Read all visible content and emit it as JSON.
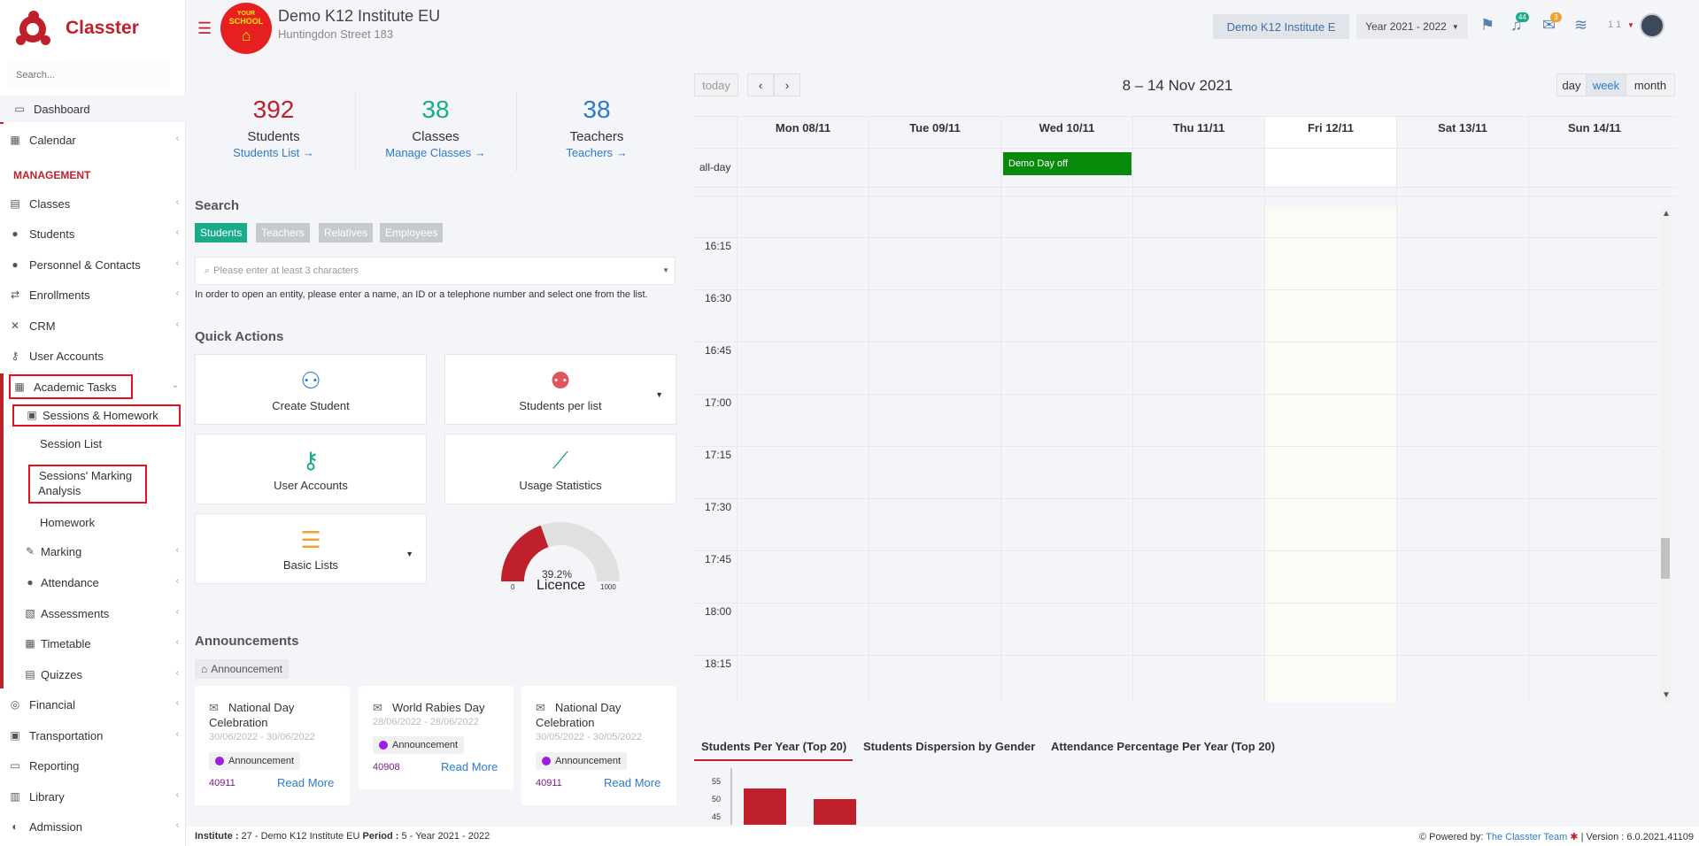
{
  "app": {
    "name": "Classter",
    "search_placeholder": "Search..."
  },
  "sidebar": {
    "dashboard": "Dashboard",
    "calendar": "Calendar",
    "management_header": "MANAGEMENT",
    "items": [
      "Classes",
      "Students",
      "Personnel & Contacts",
      "Enrollments",
      "CRM",
      "User Accounts"
    ],
    "academic_tasks": "Academic Tasks",
    "sessions_homework": "Sessions & Homework",
    "session_list": "Session List",
    "marking_analysis_1": "Sessions' Marking",
    "marking_analysis_2": "Analysis",
    "homework": "Homework",
    "academic_sub": [
      "Marking",
      "Attendance",
      "Assessments",
      "Timetable",
      "Quizzes"
    ],
    "bottom_items": [
      "Financial",
      "Transportation",
      "Reporting",
      "Library",
      "Admission"
    ]
  },
  "header": {
    "school_logo_text_1": "YOUR",
    "school_logo_text_2": "SCHOOL",
    "institute_name": "Demo K12 Institute EU",
    "address": "Huntingdon Street 183",
    "institute_button": "Demo K12 Institute E",
    "year_select": "Year 2021 - 2022",
    "notifications_count": "44",
    "messages_count": "3",
    "user_short": "1 1"
  },
  "stats": [
    {
      "value": "392",
      "label": "Students",
      "link": "Students List",
      "color": "#c0202b"
    },
    {
      "value": "38",
      "label": "Classes",
      "link": "Manage Classes",
      "color": "#1aab8a"
    },
    {
      "value": "38",
      "label": "Teachers",
      "link": "Teachers",
      "color": "#2c7cc9"
    }
  ],
  "search": {
    "title": "Search",
    "tabs": [
      "Students",
      "Teachers",
      "Relatives",
      "Employees"
    ],
    "placeholder": "Please enter at least 3 characters",
    "hint": "In order to open an entity, please enter a name, an ID or a telephone number and select one from the list."
  },
  "quick_actions": {
    "title": "Quick Actions",
    "create_student": "Create Student",
    "students_per_list": "Students per list",
    "user_accounts": "User Accounts",
    "usage_statistics": "Usage Statistics",
    "basic_lists": "Basic Lists"
  },
  "licence": {
    "percent_label": "39.2%",
    "fraction": 0.392,
    "label": "Licence",
    "min": "0",
    "max": "1000"
  },
  "announcements": {
    "title": "Announcements",
    "filter": "Announcement",
    "items": [
      {
        "title_1": "National Day",
        "title_2": "Celebration",
        "date": "30/06/2022 - 30/06/2022",
        "badge": "Announcement",
        "id": "40911",
        "read_more": "Read More"
      },
      {
        "title_1": "World Rabies Day",
        "title_2": "",
        "date": "28/06/2022 - 28/06/2022",
        "badge": "Announcement",
        "id": "40908",
        "read_more": "Read More"
      },
      {
        "title_1": "National Day",
        "title_2": "Celebration",
        "date": "30/05/2022 - 30/05/2022",
        "badge": "Announcement",
        "id": "40911",
        "read_more": "Read More"
      }
    ]
  },
  "calendar": {
    "today": "today",
    "prev": "‹",
    "next": "›",
    "title": "8 – 14 Nov 2021",
    "views": [
      "day",
      "week",
      "month"
    ],
    "days": [
      "Mon 08/11",
      "Tue 09/11",
      "Wed 10/11",
      "Thu 11/11",
      "Fri 12/11",
      "Sat 13/11",
      "Sun 14/11"
    ],
    "allday": "all-day",
    "event": "Demo Day off",
    "times": [
      "16:15",
      "16:30",
      "16:45",
      "17:00",
      "17:15",
      "17:30",
      "17:45",
      "18:00",
      "18:15"
    ]
  },
  "chart_tabs": [
    "Students Per Year (Top 20)",
    "Students Dispersion by Gender",
    "Attendance Percentage Per Year (Top 20)"
  ],
  "chart_data": {
    "type": "bar",
    "title": "Students Per Year (Top 20)",
    "y_ticks": [
      "55",
      "50",
      "45"
    ],
    "ylim": [
      45,
      55
    ],
    "values": [
      53,
      50
    ],
    "color": "#c0202b"
  },
  "footer": {
    "institute_label": "Institute :",
    "institute_value": " 27 - Demo K12 Institute EU ",
    "period_label": "Period :",
    "period_value": " 5 - Year 2021 - 2022",
    "powered_by": "Powered by:",
    "team": "The Classter Team",
    "version": "| Version : 6.0.2021.41109"
  }
}
